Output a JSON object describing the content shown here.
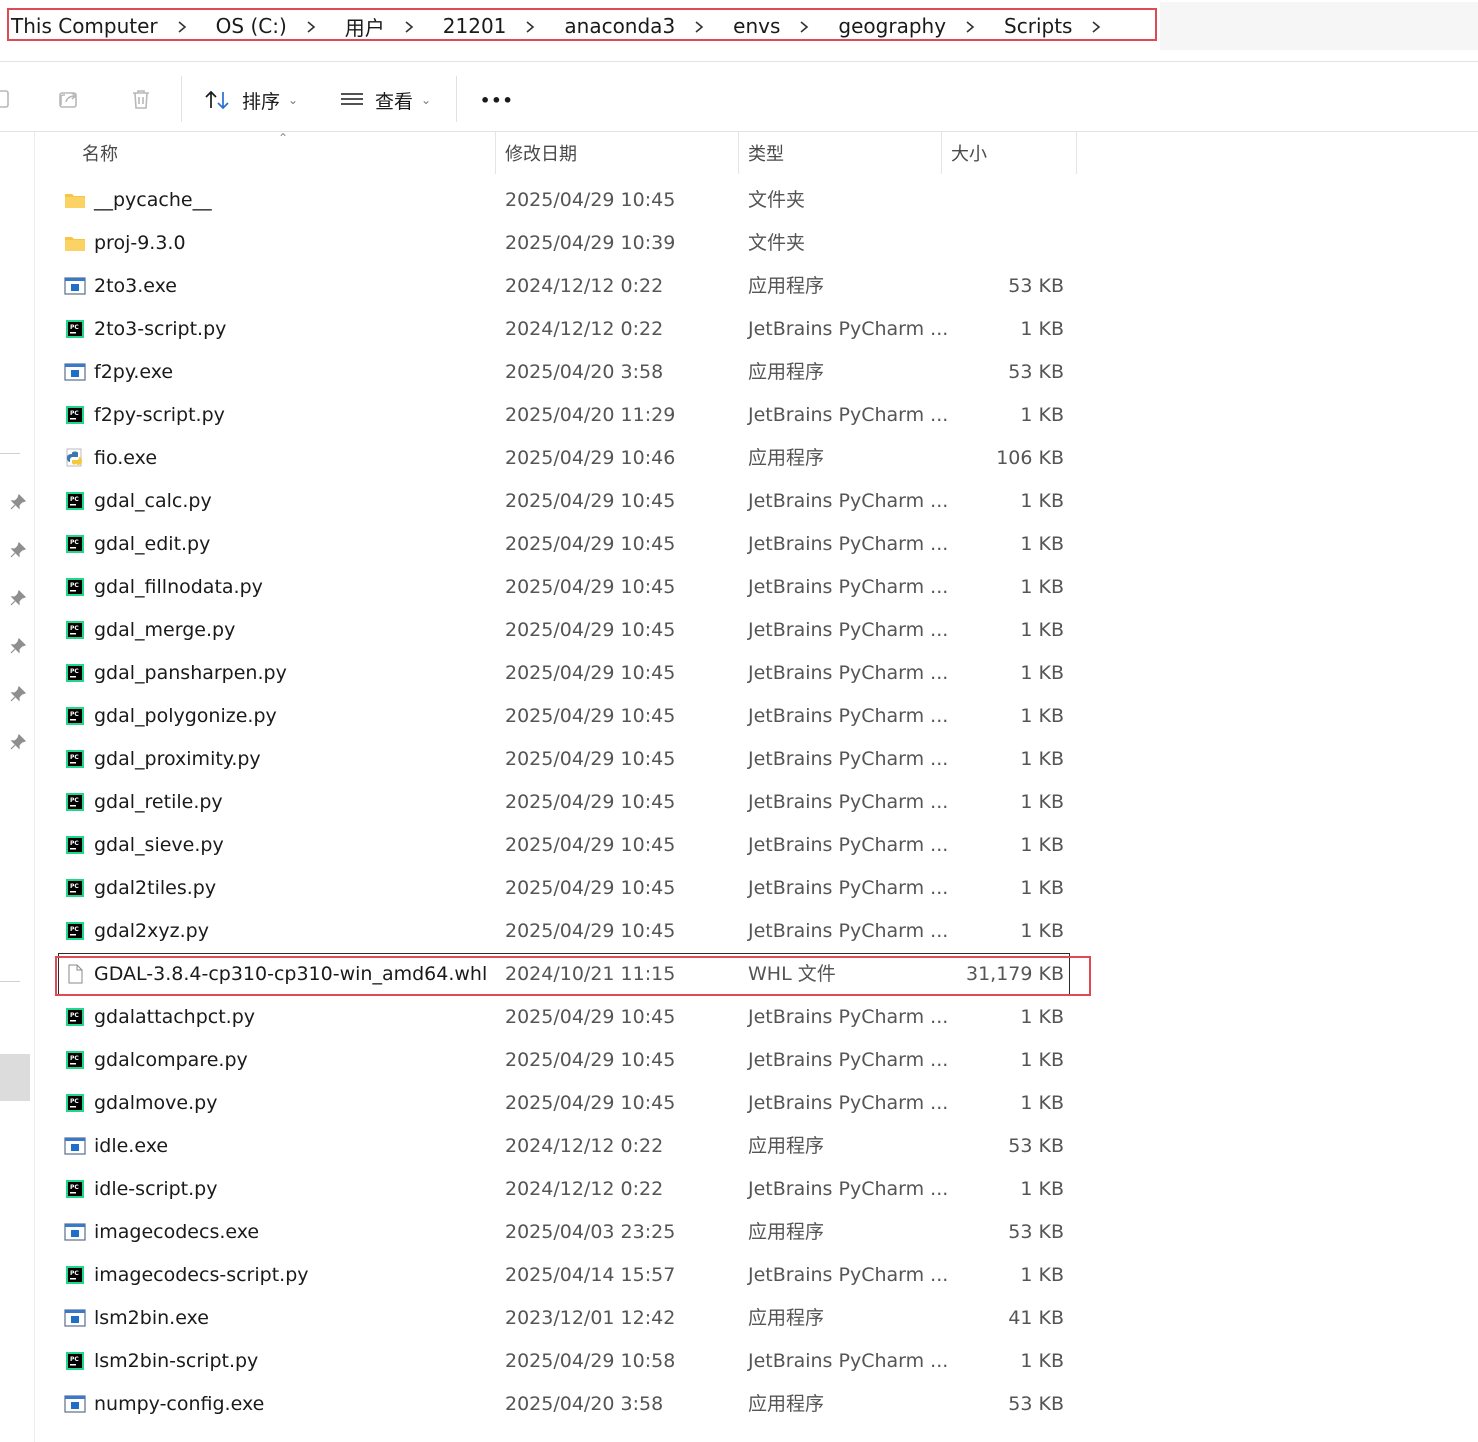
{
  "breadcrumb": [
    "This Computer",
    "OS (C:)",
    "用户",
    "21201",
    "anaconda3",
    "envs",
    "geography",
    "Scripts"
  ],
  "toolbar": {
    "sort_label": "排序",
    "view_label": "查看",
    "more_label": "•••"
  },
  "columns": {
    "name": "名称",
    "date": "修改日期",
    "type": "类型",
    "size": "大小"
  },
  "files": [
    {
      "name": "__pycache__",
      "date": "2025/04/29 10:45",
      "type": "文件夹",
      "size": "",
      "icon": "folder-icon"
    },
    {
      "name": "proj-9.3.0",
      "date": "2025/04/29 10:39",
      "type": "文件夹",
      "size": "",
      "icon": "folder-icon"
    },
    {
      "name": "2to3.exe",
      "date": "2024/12/12 0:22",
      "type": "应用程序",
      "size": "53 KB",
      "icon": "exe-icon"
    },
    {
      "name": "2to3-script.py",
      "date": "2024/12/12 0:22",
      "type": "JetBrains PyCharm ...",
      "size": "1 KB",
      "icon": "pycharm-icon"
    },
    {
      "name": "f2py.exe",
      "date": "2025/04/20 3:58",
      "type": "应用程序",
      "size": "53 KB",
      "icon": "exe-icon"
    },
    {
      "name": "f2py-script.py",
      "date": "2025/04/20 11:29",
      "type": "JetBrains PyCharm ...",
      "size": "1 KB",
      "icon": "pycharm-icon"
    },
    {
      "name": "fio.exe",
      "date": "2025/04/29 10:46",
      "type": "应用程序",
      "size": "106 KB",
      "icon": "python-exe-icon"
    },
    {
      "name": "gdal_calc.py",
      "date": "2025/04/29 10:45",
      "type": "JetBrains PyCharm ...",
      "size": "1 KB",
      "icon": "pycharm-icon"
    },
    {
      "name": "gdal_edit.py",
      "date": "2025/04/29 10:45",
      "type": "JetBrains PyCharm ...",
      "size": "1 KB",
      "icon": "pycharm-icon"
    },
    {
      "name": "gdal_fillnodata.py",
      "date": "2025/04/29 10:45",
      "type": "JetBrains PyCharm ...",
      "size": "1 KB",
      "icon": "pycharm-icon"
    },
    {
      "name": "gdal_merge.py",
      "date": "2025/04/29 10:45",
      "type": "JetBrains PyCharm ...",
      "size": "1 KB",
      "icon": "pycharm-icon"
    },
    {
      "name": "gdal_pansharpen.py",
      "date": "2025/04/29 10:45",
      "type": "JetBrains PyCharm ...",
      "size": "1 KB",
      "icon": "pycharm-icon"
    },
    {
      "name": "gdal_polygonize.py",
      "date": "2025/04/29 10:45",
      "type": "JetBrains PyCharm ...",
      "size": "1 KB",
      "icon": "pycharm-icon"
    },
    {
      "name": "gdal_proximity.py",
      "date": "2025/04/29 10:45",
      "type": "JetBrains PyCharm ...",
      "size": "1 KB",
      "icon": "pycharm-icon"
    },
    {
      "name": "gdal_retile.py",
      "date": "2025/04/29 10:45",
      "type": "JetBrains PyCharm ...",
      "size": "1 KB",
      "icon": "pycharm-icon"
    },
    {
      "name": "gdal_sieve.py",
      "date": "2025/04/29 10:45",
      "type": "JetBrains PyCharm ...",
      "size": "1 KB",
      "icon": "pycharm-icon"
    },
    {
      "name": "gdal2tiles.py",
      "date": "2025/04/29 10:45",
      "type": "JetBrains PyCharm ...",
      "size": "1 KB",
      "icon": "pycharm-icon"
    },
    {
      "name": "gdal2xyz.py",
      "date": "2025/04/29 10:45",
      "type": "JetBrains PyCharm ...",
      "size": "1 KB",
      "icon": "pycharm-icon"
    },
    {
      "name": "GDAL-3.8.4-cp310-cp310-win_amd64.whl",
      "date": "2024/10/21 11:15",
      "type": "WHL 文件",
      "size": "31,179 KB",
      "icon": "file-icon",
      "selected": true
    },
    {
      "name": "gdalattachpct.py",
      "date": "2025/04/29 10:45",
      "type": "JetBrains PyCharm ...",
      "size": "1 KB",
      "icon": "pycharm-icon"
    },
    {
      "name": "gdalcompare.py",
      "date": "2025/04/29 10:45",
      "type": "JetBrains PyCharm ...",
      "size": "1 KB",
      "icon": "pycharm-icon"
    },
    {
      "name": "gdalmove.py",
      "date": "2025/04/29 10:45",
      "type": "JetBrains PyCharm ...",
      "size": "1 KB",
      "icon": "pycharm-icon"
    },
    {
      "name": "idle.exe",
      "date": "2024/12/12 0:22",
      "type": "应用程序",
      "size": "53 KB",
      "icon": "exe-icon"
    },
    {
      "name": "idle-script.py",
      "date": "2024/12/12 0:22",
      "type": "JetBrains PyCharm ...",
      "size": "1 KB",
      "icon": "pycharm-icon"
    },
    {
      "name": "imagecodecs.exe",
      "date": "2025/04/03 23:25",
      "type": "应用程序",
      "size": "53 KB",
      "icon": "exe-icon"
    },
    {
      "name": "imagecodecs-script.py",
      "date": "2025/04/14 15:57",
      "type": "JetBrains PyCharm ...",
      "size": "1 KB",
      "icon": "pycharm-icon"
    },
    {
      "name": "lsm2bin.exe",
      "date": "2023/12/01 12:42",
      "type": "应用程序",
      "size": "41 KB",
      "icon": "exe-icon"
    },
    {
      "name": "lsm2bin-script.py",
      "date": "2025/04/29 10:58",
      "type": "JetBrains PyCharm ...",
      "size": "1 KB",
      "icon": "pycharm-icon"
    },
    {
      "name": "numpy-config.exe",
      "date": "2025/04/20 3:58",
      "type": "应用程序",
      "size": "53 KB",
      "icon": "exe-icon"
    }
  ],
  "colors": {
    "highlight": "#e04a52",
    "folder": "#f5c243",
    "exe_blue": "#1f6fc7",
    "pycharm_green": "#21d789"
  }
}
